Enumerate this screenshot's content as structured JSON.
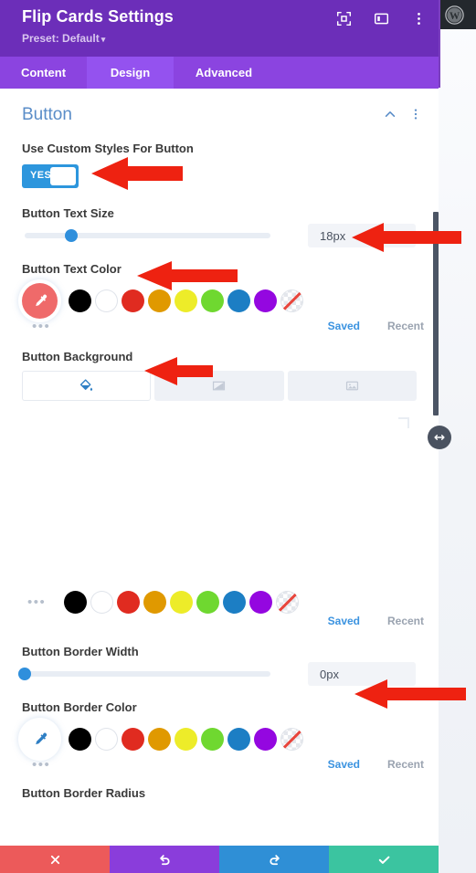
{
  "header": {
    "title": "Flip Cards Settings",
    "preset_label": "Preset: Default",
    "caret": "▾",
    "icons": [
      {
        "name": "focus-mode-icon",
        "label": "focus-mode"
      },
      {
        "name": "panel-layout-icon",
        "label": "panel-layout"
      },
      {
        "name": "more-options-icon",
        "label": "more-options"
      }
    ]
  },
  "tabs": [
    {
      "label": "Content",
      "active": false
    },
    {
      "label": "Design",
      "active": true
    },
    {
      "label": "Advanced",
      "active": false
    }
  ],
  "section": {
    "title": "Button",
    "collapse_icon": "chevron-up-icon",
    "menu_icon": "more-options-icon"
  },
  "fields": {
    "custom_styles": {
      "label": "Use Custom Styles For Button",
      "toggle_value": "YES",
      "toggle_on": true
    },
    "text_size": {
      "label": "Button Text Size",
      "value": "18px",
      "slider_percent": 19
    },
    "text_color": {
      "label": "Button Text Color",
      "active_swatch": "#ef6a6a",
      "active_icon": "eyedropper-icon"
    },
    "background": {
      "label": "Button Background",
      "tabs": [
        {
          "name": "background-color-tab",
          "icon": "paint-bucket-icon",
          "active": true
        },
        {
          "name": "background-gradient-tab",
          "icon": "gradient-icon",
          "active": false
        },
        {
          "name": "background-image-tab",
          "icon": "image-icon",
          "active": false
        }
      ]
    },
    "border_width": {
      "label": "Button Border Width",
      "value": "0px",
      "slider_percent": 0
    },
    "border_color": {
      "label": "Button Border Color",
      "active_swatch": "#ffffff",
      "active_icon": "eyedropper-icon"
    },
    "border_radius": {
      "label": "Button Border Radius"
    }
  },
  "palette": {
    "swatches": [
      {
        "name": "swatch-black",
        "color": "#000000"
      },
      {
        "name": "swatch-white",
        "color": "#ffffff"
      },
      {
        "name": "swatch-red",
        "color": "#e02b20"
      },
      {
        "name": "swatch-orange",
        "color": "#e09900"
      },
      {
        "name": "swatch-yellow",
        "color": "#edec29"
      },
      {
        "name": "swatch-green",
        "color": "#6fd830"
      },
      {
        "name": "swatch-blue",
        "color": "#1c7ec4"
      },
      {
        "name": "swatch-purple",
        "color": "#9407e0"
      },
      {
        "name": "swatch-transparent",
        "color": "transparent"
      }
    ],
    "more_label": "•••",
    "saved_label": "Saved",
    "recent_label": "Recent"
  },
  "resize_handle": {
    "name": "panel-resize-handle",
    "icon": "arrows-horizontal-icon"
  },
  "scrollbar": {
    "name": "panel-scrollbar"
  },
  "actions": [
    {
      "name": "discard-button",
      "icon": "close-icon",
      "color": "#ec5a5a"
    },
    {
      "name": "undo-button",
      "icon": "undo-icon",
      "color": "#8a3ddb"
    },
    {
      "name": "redo-button",
      "icon": "redo-icon",
      "color": "#2f8fd6"
    },
    {
      "name": "save-button",
      "icon": "check-icon",
      "color": "#3bc4a0"
    }
  ],
  "annotations": {
    "arrow_color": "#ee2211",
    "arrows": [
      {
        "name": "arrow-to-custom-styles-toggle"
      },
      {
        "name": "arrow-to-text-size-value"
      },
      {
        "name": "arrow-to-text-color-label"
      },
      {
        "name": "arrow-to-background-label"
      },
      {
        "name": "arrow-to-border-width-value"
      }
    ]
  }
}
